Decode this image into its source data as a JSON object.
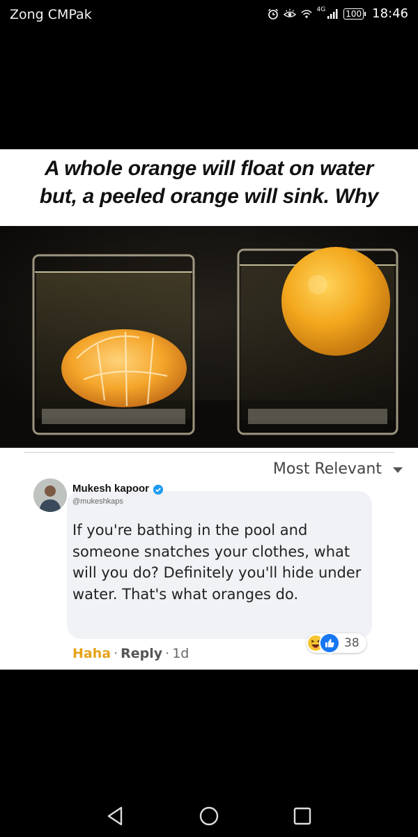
{
  "status_bar": {
    "carrier": "Zong CMPak",
    "network_type": "4G",
    "battery": "100",
    "time": "18:46",
    "icons": [
      "alarm-icon",
      "eye-comfort-icon",
      "wifi-icon",
      "signal-icon",
      "battery-icon"
    ]
  },
  "post": {
    "headline_line1": "A whole orange will float on water",
    "headline_line2": "but, a peeled orange will sink. Why"
  },
  "comments": {
    "sort_label": "Most Relevant",
    "comment": {
      "author": "Mukesh kapoor",
      "handle": "@mukeshkaps",
      "text": "If you're bathing in the pool and someone snatches your clothes, what will you do? Definitely you'll hide under water. That's what oranges do.",
      "reaction_count": "38",
      "actions": {
        "haha": "Haha",
        "reply": "Reply",
        "time": "1d"
      }
    }
  },
  "colors": {
    "accent_haha": "#e6a31a",
    "like_blue": "#1877f2",
    "verified_blue": "#1d9bf0",
    "bubble_bg": "#f0f2f5"
  }
}
